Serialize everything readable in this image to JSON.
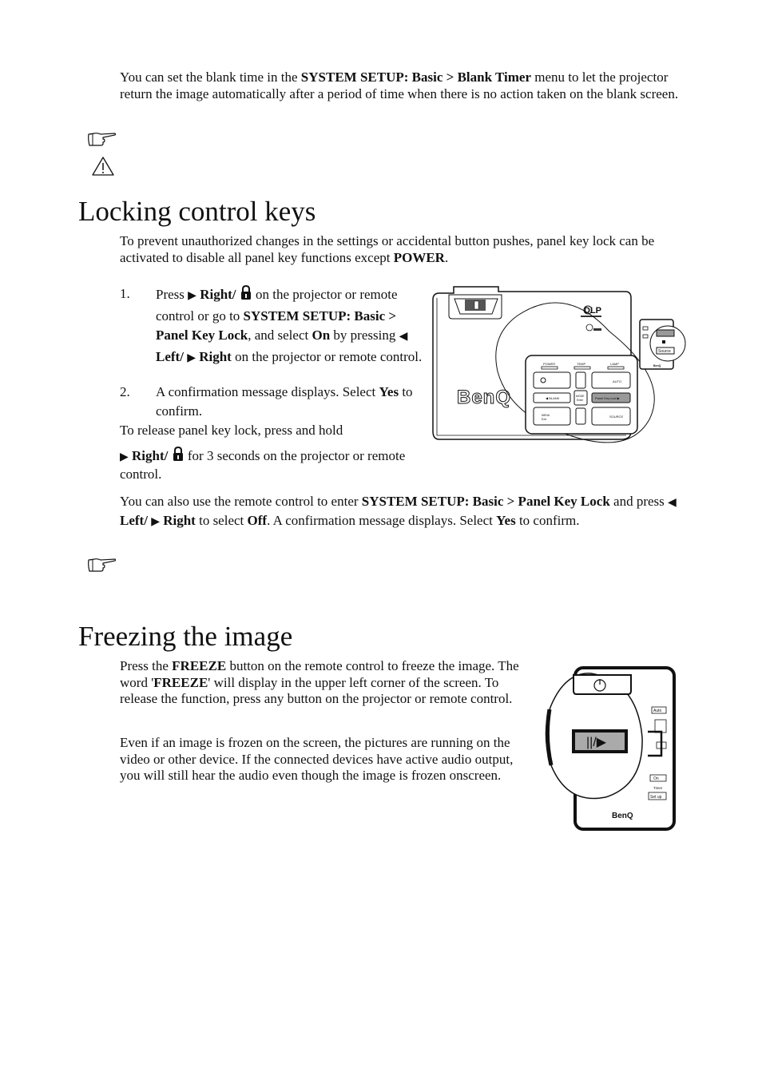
{
  "blank_section": {
    "para": {
      "t1": "You can set the blank time in the ",
      "menu": "SYSTEM SETUP: Basic > Blank Timer",
      "t2": " menu to let the projector return the image automatically after a period of time when there is no action taken on the blank screen."
    },
    "note_icon": "pointing-hand-icon",
    "warning_icon": "warning-triangle-icon"
  },
  "locking": {
    "title": "Locking control keys",
    "intro": {
      "t1": "To prevent unauthorized changes in the settings or accidental button pushes, panel key lock can be activated to disable all panel key functions except ",
      "power": "POWER",
      "t2": "."
    },
    "steps": [
      {
        "num": "1.",
        "press": "Press ",
        "arrow_right": "▶",
        "right_label": "Right/",
        "t_after_lock": " on the projector or remote control or go to ",
        "menu": "SYSTEM SETUP: Basic > Panel Key Lock",
        "t_select": ", and select ",
        "on": "On",
        "t_by": " by pressing ",
        "arrow_left": "◀",
        "left_label": "Left/",
        "arrow_right2": "▶",
        "right_label2": "Right",
        "t_end": " on the projector or remote control."
      },
      {
        "num": "2.",
        "t1": "A confirmation message displays. Select ",
        "yes": "Yes",
        "t2": " to confirm."
      }
    ],
    "release": {
      "t1": "To release panel key lock, press and hold",
      "arrow_right": "▶",
      "right_label": "Right/",
      "t2": " for 3 seconds on the projector or remote control."
    },
    "remote_para": {
      "t1": "You can also use the remote control to enter ",
      "menu": "SYSTEM SETUP: Basic > Panel Key Lock",
      "t2": " and press ",
      "arrow_left": "◀",
      "left_label": "Left/",
      "arrow_right": "▶",
      "right_label": "Right",
      "t3": " to select ",
      "off": "Off",
      "t4": ". A confirmation message displays. Select ",
      "yes": "Yes",
      "t5": " to confirm."
    },
    "figure": {
      "brand": "BenQ",
      "dlp": "DLP",
      "labels": {
        "power": "POWER",
        "temp": "TEMP",
        "lamp": "LAMP",
        "auto": "AUTO",
        "blank": "◀ BLANK",
        "mode": "MODE",
        "enter": "Enter",
        "panel_key_lock": "Panel Key lock ▶",
        "menu": "MENU",
        "exit": "Exit",
        "source": "SOURCE"
      },
      "remote_inset": {
        "source": "Source",
        "brand": "BenQ"
      }
    }
  },
  "freezing": {
    "title": "Freezing the image",
    "para1": {
      "t1": "Press the ",
      "freeze": "FREEZE",
      "t2": " button on the remote control to freeze the image. The word '",
      "freeze2": "FREEZE",
      "t3": "' will display in the upper left corner of the screen. To release the function, press any button on the projector or remote control."
    },
    "para2": "Even if an image is frozen on the screen, the pictures are running on the video or other device. If the connected devices have active audio output, you will still hear the audio even though the image is frozen onscreen.",
    "figure": {
      "freeze_button": "||/▶",
      "auto": "Auto",
      "on": "On",
      "timer": "Timer",
      "setup": "Set up",
      "brand": "BenQ"
    }
  }
}
